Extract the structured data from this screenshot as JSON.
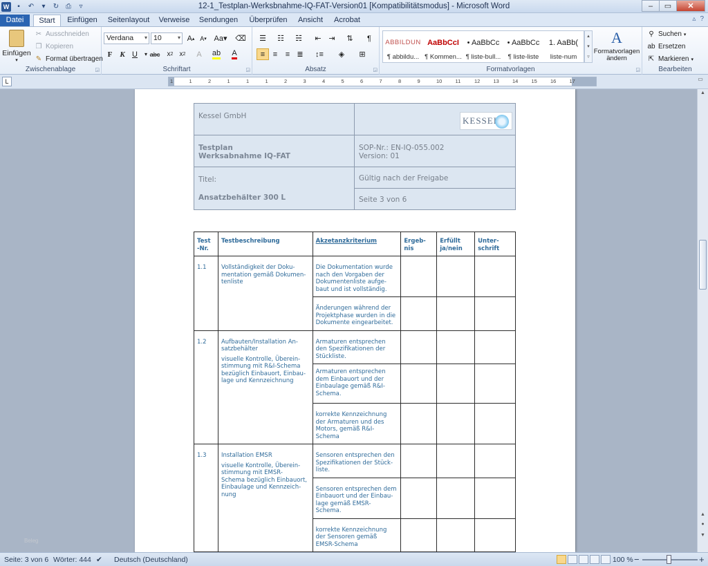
{
  "window": {
    "title": "12-1_Testplan-Werksbnahme-IQ-FAT-Version01 [Kompatibilitätsmodus] - Microsoft Word"
  },
  "tabs": [
    "Datei",
    "Start",
    "Einfügen",
    "Seitenlayout",
    "Verweise",
    "Sendungen",
    "Überprüfen",
    "Ansicht",
    "Acrobat"
  ],
  "active_tab": "Start",
  "ribbon": {
    "clipboard": {
      "paste": "Einfügen",
      "cut": "Ausschneiden",
      "copy": "Kopieren",
      "format_painter": "Format übertragen",
      "label": "Zwischenablage"
    },
    "font": {
      "name": "Verdana",
      "size": "10",
      "label": "Schriftart"
    },
    "paragraph": {
      "label": "Absatz"
    },
    "styles": {
      "items": [
        {
          "preview": "ABBILDUN",
          "name": "¶ abbildu..."
        },
        {
          "preview": "AaBbCcI",
          "name": "¶ Kommen..."
        },
        {
          "preview": "• AaBbCc",
          "name": "¶ liste-bull..."
        },
        {
          "preview": "• AaBbCc",
          "name": "¶ liste-liste"
        },
        {
          "preview": "1. AaBb(",
          "name": "liste-num"
        }
      ],
      "change": "Formatvorlagen ändern",
      "label": "Formatvorlagen"
    },
    "editing": {
      "find": "Suchen",
      "replace": "Ersetzen",
      "select": "Markieren",
      "label": "Bearbeiten"
    }
  },
  "ruler": {
    "ticks": [
      "1",
      "1",
      "2",
      "1",
      "1",
      "1",
      "2",
      "3",
      "4",
      "5",
      "6",
      "7",
      "8",
      "9",
      "10",
      "11",
      "12",
      "13",
      "14",
      "15",
      "16",
      "17"
    ]
  },
  "document": {
    "header": {
      "company": "Kessel GmbH",
      "logo_text": "KESSEL",
      "doc_title_1": "Testplan",
      "doc_title_2": "Werksabnahme IQ-FAT",
      "sop": "SOP-Nr.: EN-IQ-055.002",
      "version": "Version: 01",
      "title_label": "Titel:",
      "validity": "Gültig nach der Freigabe",
      "subject": "Ansatzbehälter 300 L",
      "page": "Seite 3 von 6"
    },
    "table": {
      "headers": [
        "Test\n-Nr.",
        "Testbeschreibung",
        "Akzetanzkriterium",
        "Ergeb-\nnis",
        "Erfüllt\nja/nein",
        "Unter-\nschrift"
      ],
      "rows": [
        {
          "nr": "1.1",
          "desc": "Vollständigkeit der Doku-\nmentation gemäß Dokumen-\ntenliste",
          "criteria": [
            "Die Dokumentation wurde\nnach den Vorgaben der\nDokumentenliste aufge-\nbaut und ist vollständig.",
            "Änderungen während der\nProjektphase wurden in die\nDokumente eingearbeitet."
          ]
        },
        {
          "nr": "1.2",
          "desc": "Aufbauten/Installation An-\nsatzbehälter",
          "desc2": "visuelle Kontrolle, Überein-\nstimmung mit R&I-Schema\nbezüglich Einbauort, Einbau-\nlage und Kennzeichnung",
          "criteria": [
            "Armaturen entsprechen\nden Spezifikationen der\nStückliste.",
            "Armaturen entsprechen\ndem Einbauort und der\nEinbaulage gemäß R&I-\nSchema.",
            "korrekte Kennzeichnung\nder Armaturen und des\nMotors, gemäß R&I-\nSchema"
          ]
        },
        {
          "nr": "1.3",
          "desc": "Installation EMSR",
          "desc2": "visuelle Kontrolle, Überein-\nstimmung mit EMSR-\nSchema bezüglich Einbauort,\nEinbaulage und Kennzeich-\nnung",
          "criteria": [
            "Sensoren entsprechen den\nSpezifikationen der Stück-\nliste.",
            "Sensoren entsprechen dem\nEinbauort und der Einbau-\nlage gemäß EMSR-\nSchema.",
            "korrekte Kennzeichnung\nder Sensoren gemäß\nEMSR-Schema"
          ]
        }
      ]
    },
    "watermark": "Beleg"
  },
  "status": {
    "page": "Seite: 3 von 6",
    "words": "Wörter: 444",
    "language": "Deutsch (Deutschland)",
    "zoom": "100 %",
    "zoom_minus": "−",
    "zoom_plus": "+"
  }
}
